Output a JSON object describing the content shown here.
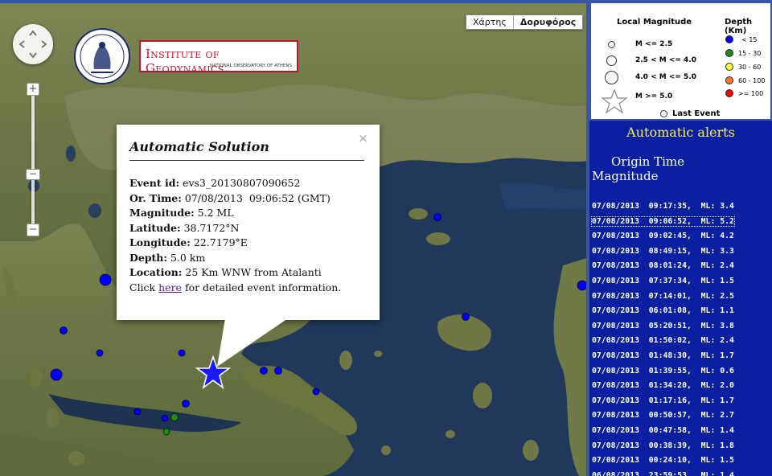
{
  "map": {
    "type_buttons": [
      "Χάρτης",
      "Δορυφόρος"
    ],
    "active_type": "Δορυφόρος",
    "zoom_in": "+",
    "zoom_out": "−",
    "zoom_thumb": "−",
    "logo": {
      "title": "Institute of Geodynamics",
      "subtitle": "NATIONAL OBSERVATORY OF ATHENS"
    },
    "popup": {
      "close": "×",
      "title": "Automatic Solution",
      "event_id_label": "Event id:",
      "event_id": "evs3_20130807090652",
      "time_label": "Or. Time:",
      "time": "07/08/2013  09:06:52 (GMT)",
      "magnitude_label": "Magnitude:",
      "magnitude": "5.2 ML",
      "latitude_label": "Latitude:",
      "latitude": "38.7172°N",
      "longitude_label": "Longitude:",
      "longitude": "22.7179°E",
      "depth_label": "Depth:",
      "depth": "5.0 km",
      "location_label": "Location:",
      "location": "25 Km WNW from Atalanti",
      "click_prefix": "Click",
      "link_text": "here",
      "click_suffix": "for detailed event information."
    },
    "colors": {
      "depth_lt15": "#0000ff",
      "depth_15_30": "#1a8c1a",
      "star": "#1a1aff"
    }
  },
  "legend": {
    "magnitude_title": "Local Magnitude",
    "depth_title": "Depth (Km)",
    "mag_items": [
      "M <= 2.5",
      "2.5 < M <= 4.0",
      "4.0 < M <= 5.0",
      "M >= 5.0"
    ],
    "depth_items": [
      {
        "label": "< 15",
        "color": "#0000ff"
      },
      {
        "label": "15 - 30",
        "color": "#1a8c1a"
      },
      {
        "label": "30 - 60",
        "color": "#ffff33"
      },
      {
        "label": "60 - 100",
        "color": "#ff7a1a"
      },
      {
        "label": ">= 100",
        "color": "#ff0000"
      }
    ],
    "last_event": "Last Event"
  },
  "alerts": {
    "title": "Automatic alerts",
    "col_origin": "Origin Time",
    "col_magnitude": "Magnitude",
    "rows": [
      "07/08/2013  09:17:35,  ML: 3.4",
      "07/08/2013  09:06:52,  ML: 5.2",
      "07/08/2013  09:02:45,  ML: 4.2",
      "07/08/2013  08:49:15,  ML: 3.3",
      "07/08/2013  08:01:24,  ML: 2.4",
      "07/08/2013  07:37:34,  ML: 1.5",
      "07/08/2013  07:14:01,  ML: 2.5",
      "07/08/2013  06:01:08,  ML: 1.1",
      "07/08/2013  05:20:51,  ML: 3.8",
      "07/08/2013  01:50:02,  ML: 2.4",
      "07/08/2013  01:48:30,  ML: 1.7",
      "07/08/2013  01:39:55,  ML: 0.6",
      "07/08/2013  01:34:20,  ML: 2.0",
      "07/08/2013  01:17:16,  ML: 1.7",
      "07/08/2013  00:50:57,  ML: 2.7",
      "07/08/2013  00:47:58,  ML: 1.4",
      "07/08/2013  00:38:39,  ML: 1.8",
      "07/08/2013  00:24:10,  ML: 1.5",
      "06/08/2013  23:59:53,  ML: 1.4"
    ],
    "selected_index": 1
  }
}
